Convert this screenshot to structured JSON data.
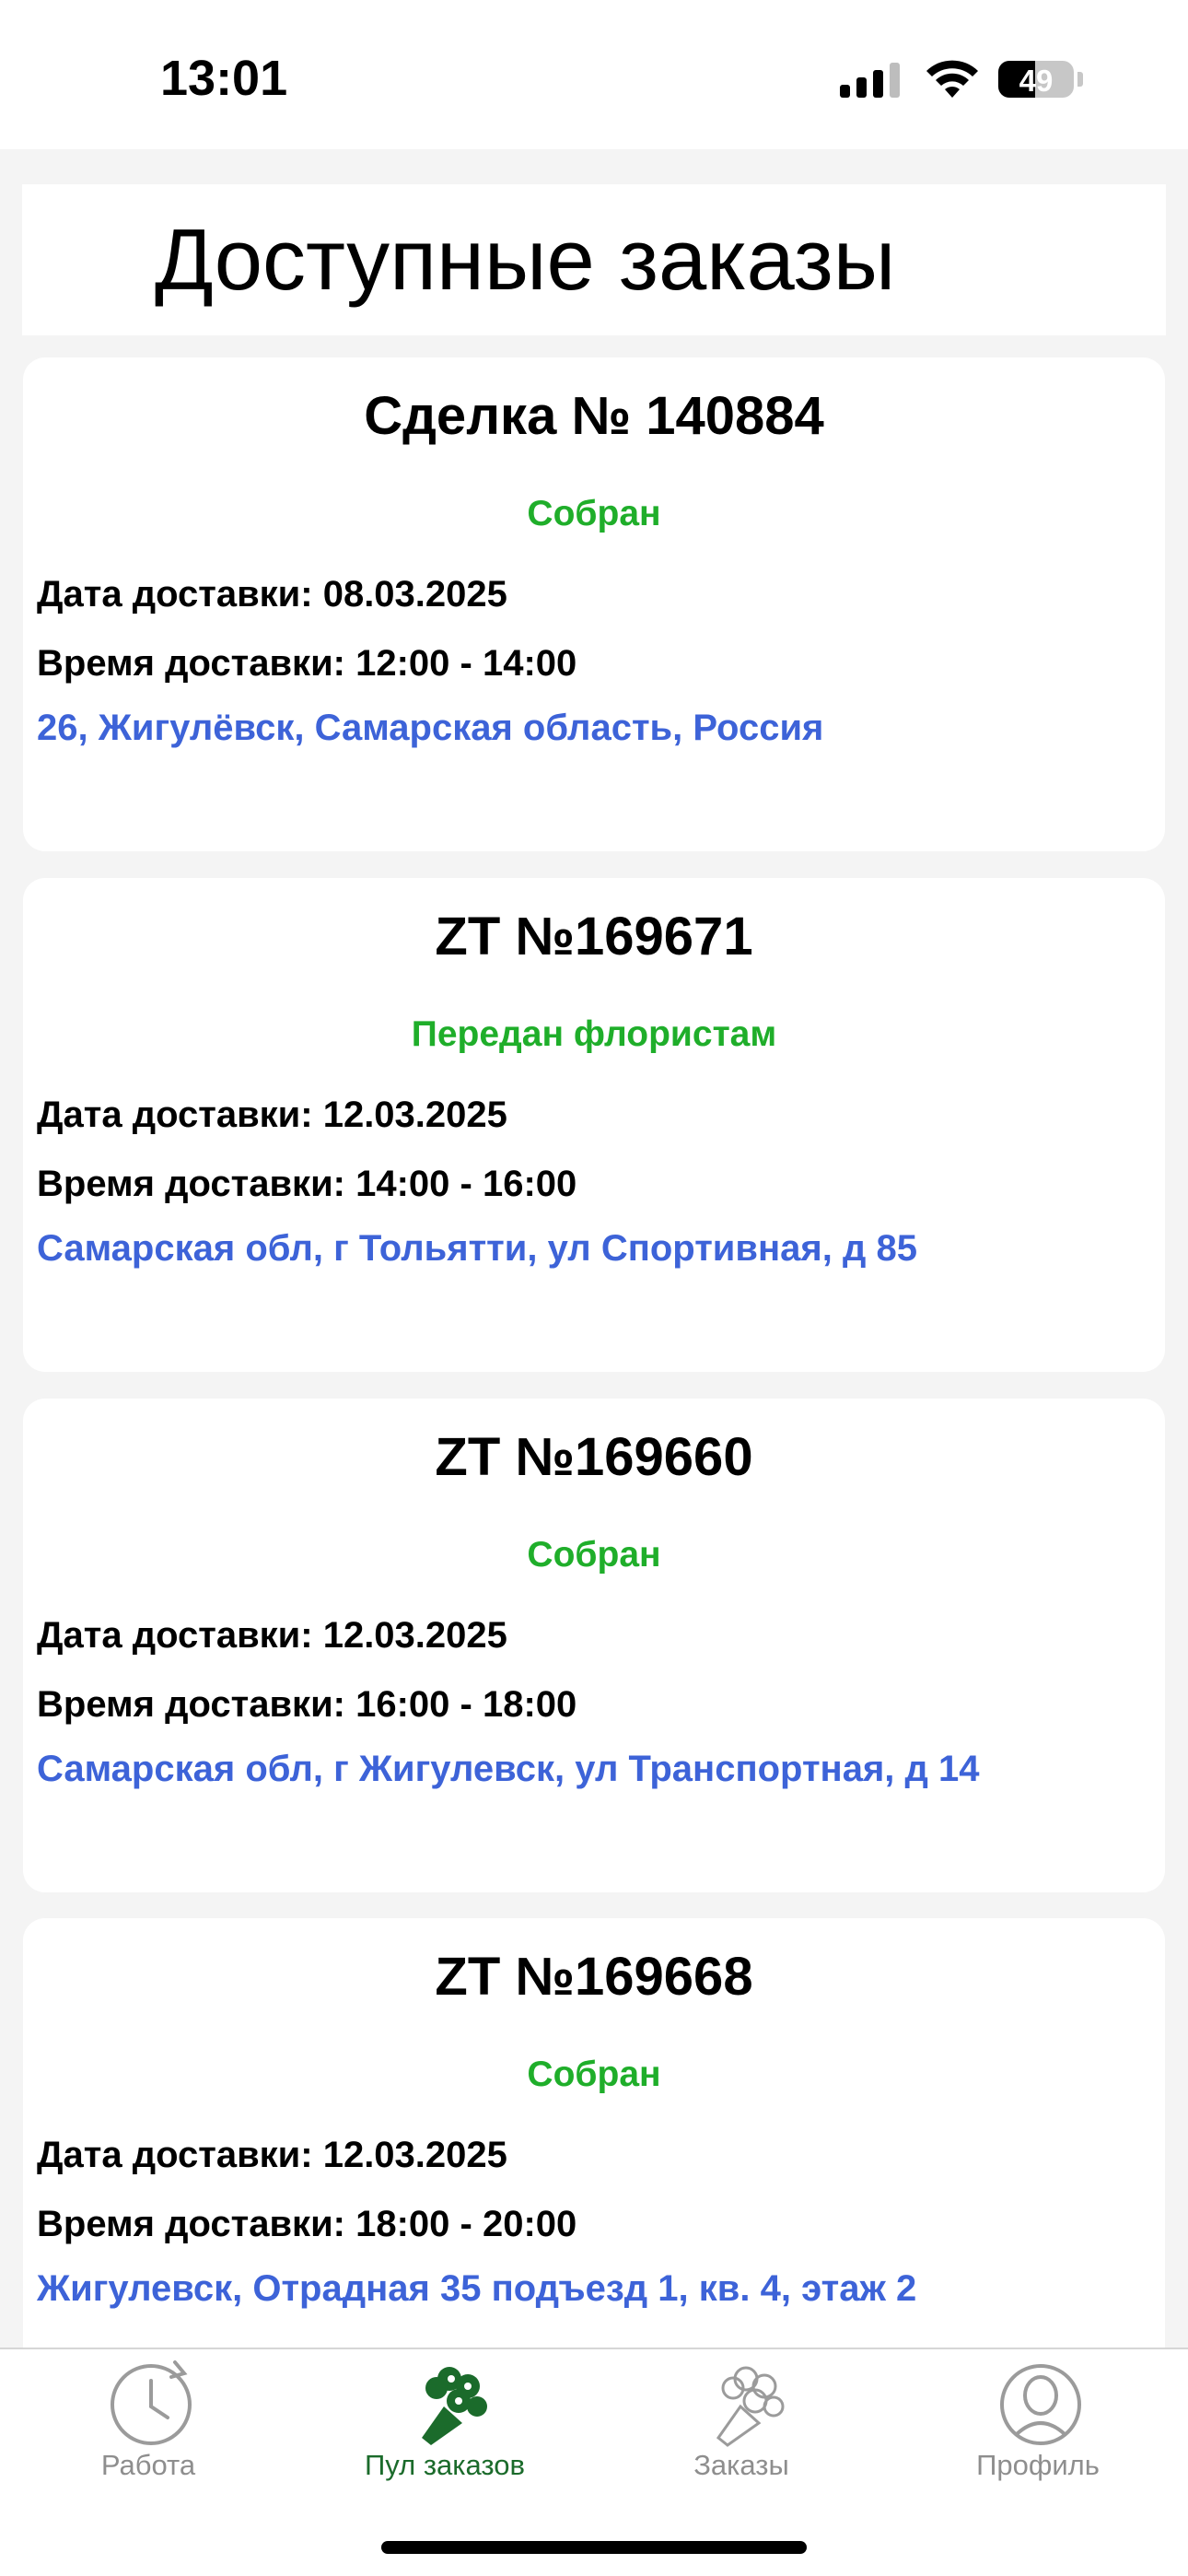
{
  "status_bar": {
    "time": "13:01",
    "battery_level": "49"
  },
  "header": {
    "title": "Доступные заказы"
  },
  "orders": [
    {
      "title": "Сделка № 140884",
      "status": "Собран",
      "delivery_date": "Дата доставки: 08.03.2025",
      "delivery_time": "Время доставки: 12:00 - 14:00",
      "address": "26, Жигулёвск, Самарская область, Россия"
    },
    {
      "title": "ZT №169671",
      "status": "Передан флористам",
      "delivery_date": "Дата доставки: 12.03.2025",
      "delivery_time": "Время доставки: 14:00 - 16:00",
      "address": "Самарская обл, г Тольятти, ул Спортивная, д 85"
    },
    {
      "title": "ZT №169660",
      "status": "Собран",
      "delivery_date": "Дата доставки: 12.03.2025",
      "delivery_time": "Время доставки: 16:00 - 18:00",
      "address": "Самарская обл, г Жигулевск, ул Транспортная, д 14"
    },
    {
      "title": "ZT №169668",
      "status": "Собран",
      "delivery_date": "Дата доставки: 12.03.2025",
      "delivery_time": "Время доставки: 18:00 - 20:00",
      "address": "Жигулевск,  Отрадная 35 подъезд 1, кв. 4, этаж 2"
    }
  ],
  "tab_bar": {
    "tabs": [
      {
        "label": "Работа",
        "icon": "clock-history-icon",
        "active": false
      },
      {
        "label": "Пул заказов",
        "icon": "bouquet-icon",
        "active": true
      },
      {
        "label": "Заказы",
        "icon": "bouquet-outline-icon",
        "active": false
      },
      {
        "label": "Профиль",
        "icon": "person-icon",
        "active": false
      }
    ]
  },
  "colors": {
    "status_green": "#1fae2a",
    "address_blue": "#3d63d8",
    "active_tab": "#1b6b2b",
    "inactive_tab": "#8e8e8e"
  }
}
